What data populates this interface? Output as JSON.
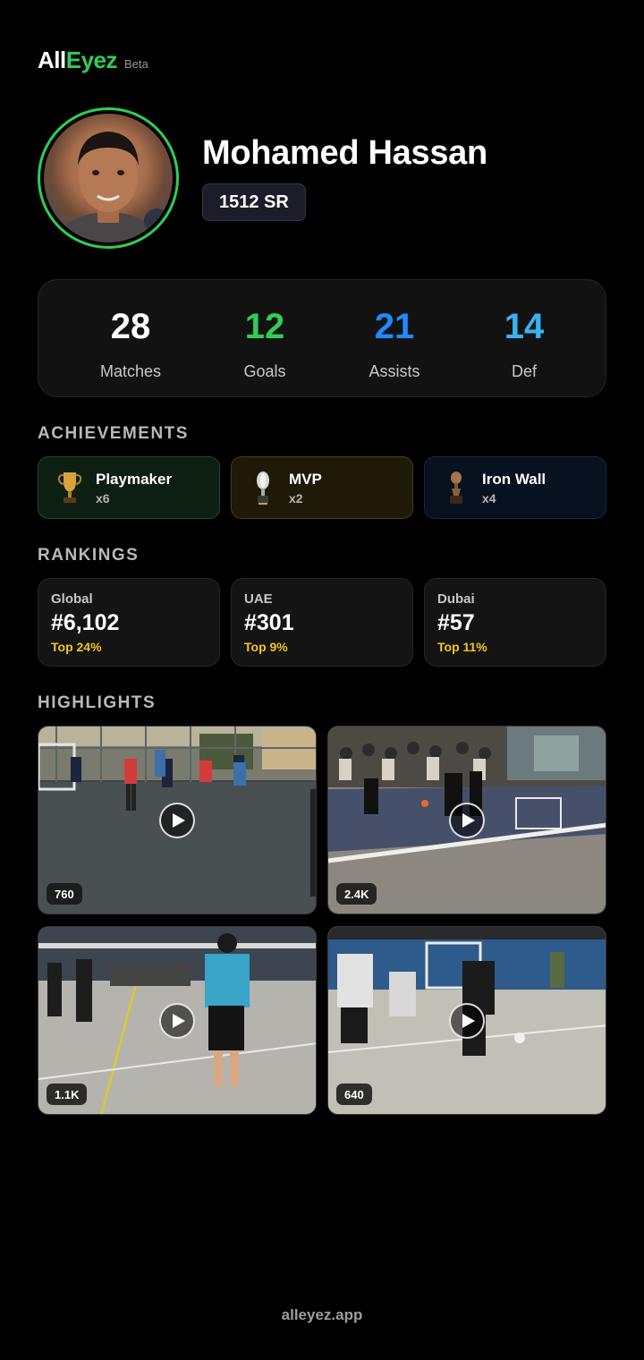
{
  "brand": {
    "part1": "All",
    "part2": "Eyez",
    "tag": "Beta"
  },
  "profile": {
    "name": "Mohamed Hassan",
    "sr": "1512 SR"
  },
  "stats": [
    {
      "value": "28",
      "label": "Matches",
      "color": "#ffffff"
    },
    {
      "value": "12",
      "label": "Goals",
      "color": "#2fce55"
    },
    {
      "value": "21",
      "label": "Assists",
      "color": "#1e8bff"
    },
    {
      "value": "14",
      "label": "Def",
      "color": "#36b3f2"
    }
  ],
  "achievements": {
    "title": "ACHIEVEMENTS",
    "items": [
      {
        "name": "Playmaker",
        "count": "x6",
        "icon": "gold-trophy-icon",
        "bg": "#0d1f12",
        "border": "#1f4a2a"
      },
      {
        "name": "MVP",
        "count": "x2",
        "icon": "silver-trophy-icon",
        "bg": "#1f1a08",
        "border": "#4a3f16"
      },
      {
        "name": "Iron Wall",
        "count": "x4",
        "icon": "bronze-trophy-icon",
        "bg": "#08111f",
        "border": "#16294a"
      }
    ]
  },
  "rankings": {
    "title": "RANKINGS",
    "items": [
      {
        "scope": "Global",
        "rank": "#6,102",
        "top": "Top 24%"
      },
      {
        "scope": "UAE",
        "rank": "#301",
        "top": "Top 9%"
      },
      {
        "scope": "Dubai",
        "rank": "#57",
        "top": "Top 11%"
      }
    ]
  },
  "highlights": {
    "title": "HIGHLIGHTS",
    "items": [
      {
        "views": "760"
      },
      {
        "views": "2.4K"
      },
      {
        "views": "1.1K"
      },
      {
        "views": "640"
      }
    ]
  },
  "footer": {
    "domain": "alleyez.app"
  }
}
